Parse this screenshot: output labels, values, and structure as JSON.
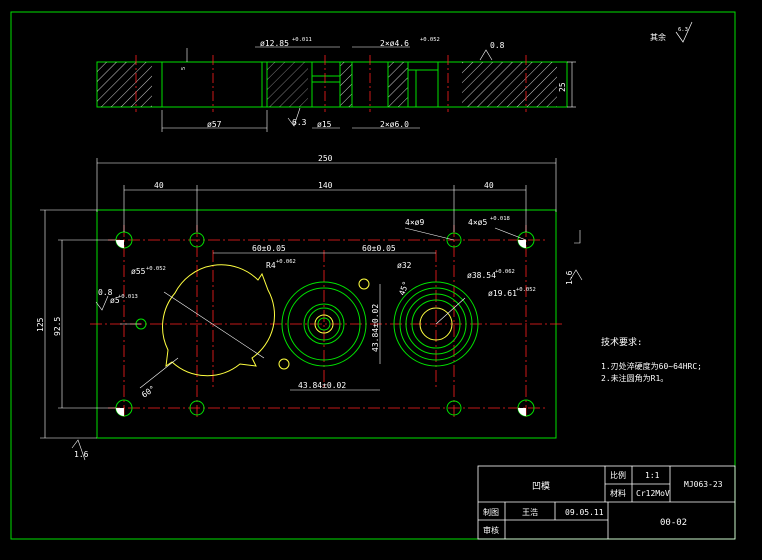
{
  "colors": {
    "outline": "#00e000",
    "center": "#ff2020",
    "dim": "#ffffff",
    "hatch": "#ffffff",
    "contour": "#ffff40",
    "background": "#000000"
  },
  "roughness": {
    "label": "其余",
    "value": "6.3",
    "top": "0.8",
    "bottom": "6.3",
    "left": "0.8",
    "left_side": "1.6",
    "right_side": "1.6",
    "lower_left": "1.6"
  },
  "section": {
    "d1": "ø12.85",
    "d1_tol": "+0.011",
    "d2": "2×ø4.6",
    "d2_tol": "+0.052",
    "d57": "ø57",
    "d15": "ø15",
    "d6": "2×ø6.0",
    "h25": "25",
    "h5": "5"
  },
  "plan": {
    "d250": "250",
    "d40a": "40",
    "d140": "140",
    "d40b": "40",
    "d125": "125",
    "d92": "92.5",
    "d60a": "60±0.05",
    "d60b": "60±0.05",
    "r4": "R4",
    "r4_tol": "+0.062",
    "d55": "ø55",
    "d55_tol": "+0.052",
    "d5": "ø5",
    "d5_tol": "+0.013",
    "d32": "ø32",
    "d38": "ø38.54",
    "d38_tol": "+0.062",
    "d19": "ø19.61",
    "d19_tol": "+0.052",
    "c4x9": "4×ø9",
    "c4x5": "4×ø5",
    "c4x5_tol": "+0.018",
    "d43v": "43.84±0.02",
    "d43h": "43.84±0.02",
    "a60": "60°",
    "a45": "45°",
    "r55": "55"
  },
  "notes": {
    "title": "技术要求:",
    "line1": "1.刃处淬硬度为60~64HRC;",
    "line2": "2.未注圆角为R1。"
  },
  "title_block": {
    "part_name": "凹模",
    "scale_label": "比例",
    "scale": "1:1",
    "material_label": "材料",
    "material": "Cr12MoV",
    "drawing_no": "MJ063-23",
    "drawn_label": "制图",
    "drawn_by": "王浩",
    "date": "09.05.11",
    "checked_label": "审核",
    "sheet": "00-02"
  }
}
